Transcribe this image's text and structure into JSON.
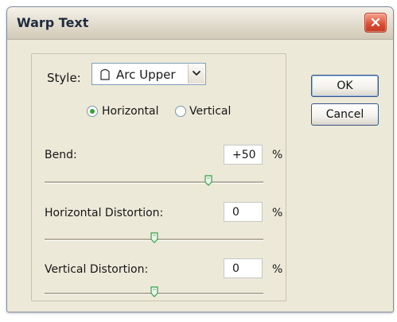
{
  "window": {
    "title": "Warp Text"
  },
  "style": {
    "label": "Style:",
    "selected": "Arc Upper"
  },
  "orientation": {
    "horizontal_label": "Horizontal",
    "vertical_label": "Vertical",
    "selected": "Horizontal"
  },
  "controls": {
    "bend": {
      "label": "Bend:",
      "value": "+50",
      "unit": "%",
      "position_fraction": 0.75
    },
    "horizontal_distortion": {
      "label": "Horizontal Distortion:",
      "value": "0",
      "unit": "%",
      "position_fraction": 0.5
    },
    "vertical_distortion": {
      "label": "Vertical Distortion:",
      "value": "0",
      "unit": "%",
      "position_fraction": 0.5
    }
  },
  "buttons": {
    "ok_label": "OK",
    "cancel_label": "Cancel"
  },
  "icons": {
    "close": "close-icon",
    "style_shape": "arc-upper-icon",
    "dropdown": "chevron-down-icon",
    "slider_thumb": "slider-thumb-icon"
  },
  "colors": {
    "dialog_background": "#ece9d8",
    "close_button": "#d84c32",
    "radio_selected": "#32a436",
    "slider_thumb": "#35a24b"
  }
}
